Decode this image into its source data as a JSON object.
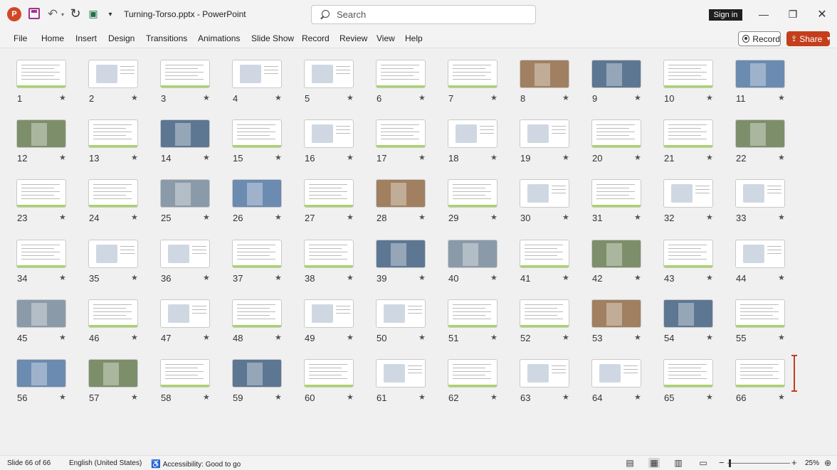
{
  "titlebar": {
    "document_title": "Turning-Torso.pptx  -  PowerPoint",
    "app_icon": "P",
    "search_placeholder": "Search",
    "signin_label": "Sign in"
  },
  "menu": {
    "items": [
      "File",
      "Home",
      "Insert",
      "Design",
      "Transitions",
      "Animations",
      "Slide Show",
      "Record",
      "Review",
      "View",
      "Help"
    ],
    "record_button": "Record",
    "share_button": "Share"
  },
  "slides": {
    "count": 66,
    "star_glyph": "★",
    "selected": 66
  },
  "status": {
    "slide_info": "Slide 66 of 66",
    "language": "English (United States)",
    "accessibility": "Accessibility: Good to go",
    "zoom": "25%"
  },
  "icons": {
    "app": "powerpoint-icon",
    "save": "save-icon",
    "undo": "undo-icon",
    "redo": "redo-icon",
    "present": "present-icon",
    "search": "search-icon"
  },
  "colors": {
    "accent": "#c43e1c",
    "slide_bar": "#a9d36b"
  }
}
